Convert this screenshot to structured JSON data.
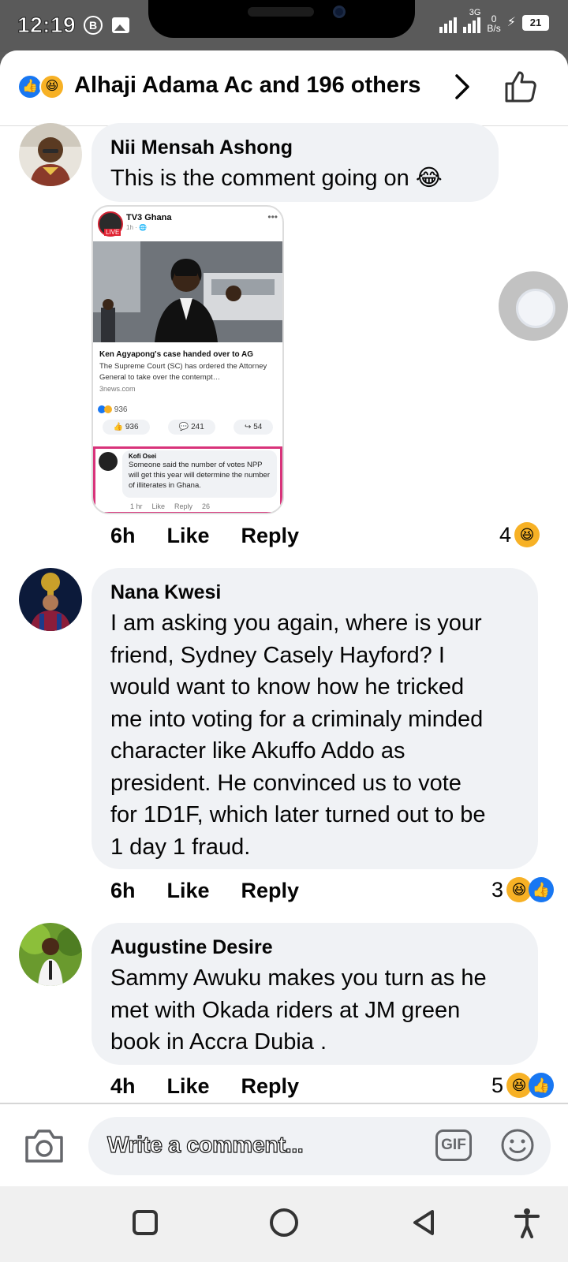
{
  "status_bar": {
    "time": "12:19",
    "network_tag": "3G",
    "net_speed_value": "0",
    "net_speed_unit": "B/s",
    "battery": "21"
  },
  "header": {
    "title": "Alhaji Adama Ac and 196 others"
  },
  "comments": [
    {
      "author": "Nii Mensah Ashong",
      "text": "This is the comment going on 😂",
      "time": "6h",
      "like_label": "Like",
      "reply_label": "Reply",
      "reaction_count": "4",
      "attachment": {
        "page_name": "TV3 Ghana",
        "post_time": "1h · 🌐",
        "live_tag": "LIVE",
        "headline": "Ken Agyapong's case handed over to AG",
        "description": "The Supreme Court (SC) has ordered the Attorney General to take over the contempt…",
        "site": "3news.com",
        "reactions": "936",
        "like_btn": "936",
        "comment_btn": "241",
        "share_btn": "54",
        "inner_comment": {
          "author": "Kofi Osei",
          "text": "Someone said the number of votes NPP will get this year will  determine the number of illiterates in Ghana.",
          "time": "1 hr",
          "like": "Like",
          "reply": "Reply",
          "count": "26"
        }
      }
    },
    {
      "author": "Nana Kwesi",
      "text_lines": [
        "I am asking you again, where is your",
        "friend, Sydney Casely Hayford? I",
        "would want to know how he tricked",
        "me into voting for a criminaly minded",
        "character like Akuffo Addo as",
        "president. He convinced us to vote",
        "for 1D1F, which later turned out to be",
        "1 day 1 fraud."
      ],
      "time": "6h",
      "like_label": "Like",
      "reply_label": "Reply",
      "reaction_count": "3"
    },
    {
      "author": "Augustine Desire",
      "text_lines": [
        "Sammy Awuku makes you turn as he",
        "met with Okada riders at JM green",
        "book in Accra  Dubia ."
      ],
      "time": "4h",
      "like_label": "Like",
      "reply_label": "Reply",
      "reaction_count": "5"
    }
  ],
  "composer": {
    "placeholder": "Write a comment...",
    "gif_label": "GIF"
  },
  "icons": {
    "like": "like-icon",
    "haha": "haha-icon",
    "camera": "camera-icon",
    "emoji": "emoji-icon"
  },
  "colors": {
    "like_blue": "#1877f2",
    "haha_yellow": "#f7b125",
    "bubble_gray": "#f0f2f5",
    "highlight_pink": "#d8337a"
  }
}
